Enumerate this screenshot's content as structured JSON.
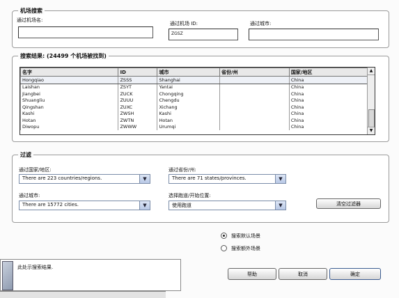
{
  "search": {
    "legend": "机场搜索",
    "name_label": "通过机场名:",
    "name_value": "",
    "id_label": "通过机场 ID:",
    "id_value": "ZGSZ",
    "city_label": "通过城市:",
    "city_value": ""
  },
  "results": {
    "legend": "搜索结果: (24499 个机场被找到)",
    "columns": [
      "名字",
      "ID",
      "城市",
      "省份/州",
      "国家/地区"
    ],
    "rows": [
      {
        "name": "Hongqiao",
        "id": "ZSSS",
        "city": "Shanghai",
        "state": "",
        "country": "China"
      },
      {
        "name": "Laishan",
        "id": "ZSYT",
        "city": "Yantai",
        "state": "",
        "country": "China"
      },
      {
        "name": "Jiangbei",
        "id": "ZUCK",
        "city": "Chongqing",
        "state": "",
        "country": "China"
      },
      {
        "name": "Shuangliu",
        "id": "ZUUU",
        "city": "Chengdu",
        "state": "",
        "country": "China"
      },
      {
        "name": "Qingshan",
        "id": "ZUXC",
        "city": "Xichang",
        "state": "",
        "country": "China"
      },
      {
        "name": "Kashi",
        "id": "ZWSH",
        "city": "Kashi",
        "state": "",
        "country": "China"
      },
      {
        "name": "Hotan",
        "id": "ZWTN",
        "city": "Hotan",
        "state": "",
        "country": "China"
      },
      {
        "name": "Diwopu",
        "id": "ZWWW",
        "city": "Urumqi",
        "state": "",
        "country": "China"
      }
    ]
  },
  "filters": {
    "legend": "过滤",
    "country_label": "通过国家/地区:",
    "country_value": "There are 223 countries/regions.",
    "state_label": "通过省份/州:",
    "state_value": "There are 71 states/provinces.",
    "city_label": "通过城市:",
    "city_value": "There are 15772 cities.",
    "runway_label": "选择跑道/开始位置:",
    "runway_value": "使用跑道",
    "clear_label": "清空过滤器"
  },
  "options": {
    "radio1_label": "搜索默认场景",
    "radio2_label": "搜索额外场景"
  },
  "status": {
    "text": "此处示搜索结果."
  },
  "footer": {
    "help_label": "帮助",
    "cancel_label": "取消",
    "ok_label": "确定"
  }
}
